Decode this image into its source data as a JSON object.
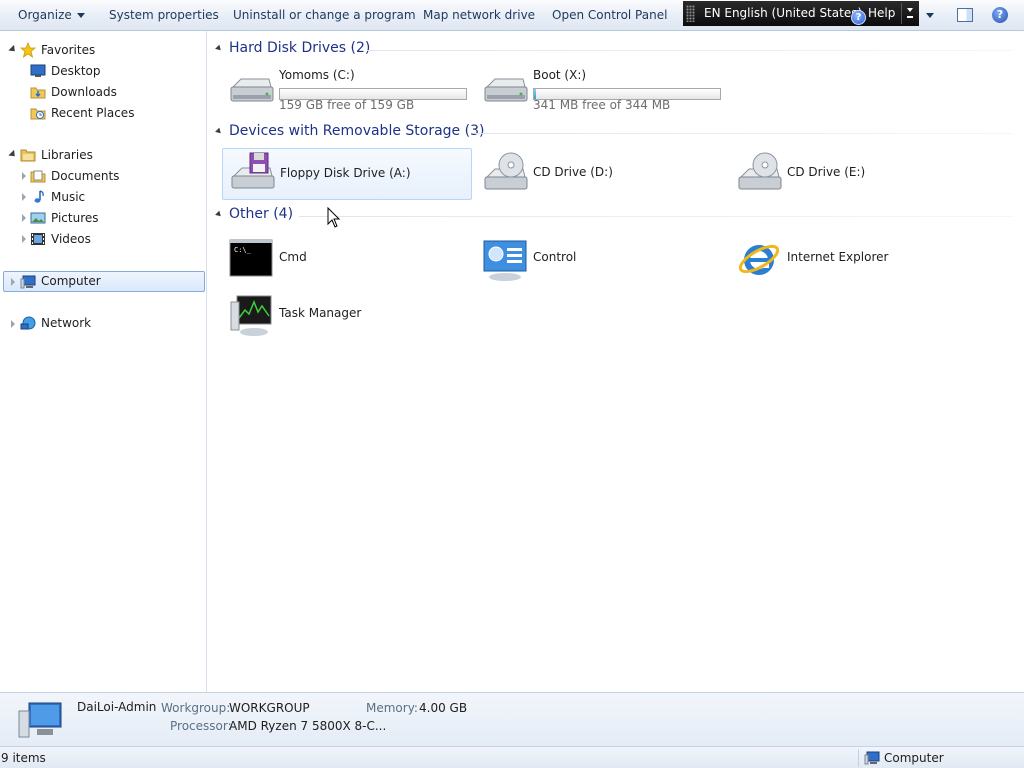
{
  "toolbar": {
    "organize": "Organize",
    "system_properties": "System properties",
    "uninstall": "Uninstall or change a program",
    "map_drive": "Map network drive",
    "open_control_panel": "Open Control Panel",
    "language": "EN English (United States)",
    "help": "Help"
  },
  "nav": {
    "favorites": "Favorites",
    "desktop": "Desktop",
    "downloads": "Downloads",
    "recent_places": "Recent Places",
    "libraries": "Libraries",
    "documents": "Documents",
    "music": "Music",
    "pictures": "Pictures",
    "videos": "Videos",
    "computer": "Computer",
    "network": "Network"
  },
  "groups": {
    "hard_disks": "Hard Disk Drives (2)",
    "removable": "Devices with Removable Storage (3)",
    "other": "Other (4)"
  },
  "drives": [
    {
      "name": "Yomoms (C:)",
      "free": "159 GB free of 159 GB",
      "used_fraction": 0.0
    },
    {
      "name": "Boot (X:)",
      "free": "341 MB free of 344 MB",
      "used_fraction": 0.01
    }
  ],
  "removable": [
    {
      "name": "Floppy Disk Drive (A:)"
    },
    {
      "name": "CD Drive (D:)"
    },
    {
      "name": "CD Drive (E:)"
    }
  ],
  "other": [
    {
      "name": "Cmd"
    },
    {
      "name": "Control"
    },
    {
      "name": "Internet Explorer"
    },
    {
      "name": "Task Manager"
    }
  ],
  "details": {
    "computer_name": "DaiLoi-Admin",
    "workgroup_label": "Workgroup:",
    "workgroup_value": "WORKGROUP",
    "memory_label": "Memory:",
    "memory_value": "4.00 GB",
    "processor_label": "Processor:",
    "processor_value": "AMD Ryzen 7 5800X 8-C..."
  },
  "status": {
    "items": "9 items",
    "location": "Computer"
  }
}
